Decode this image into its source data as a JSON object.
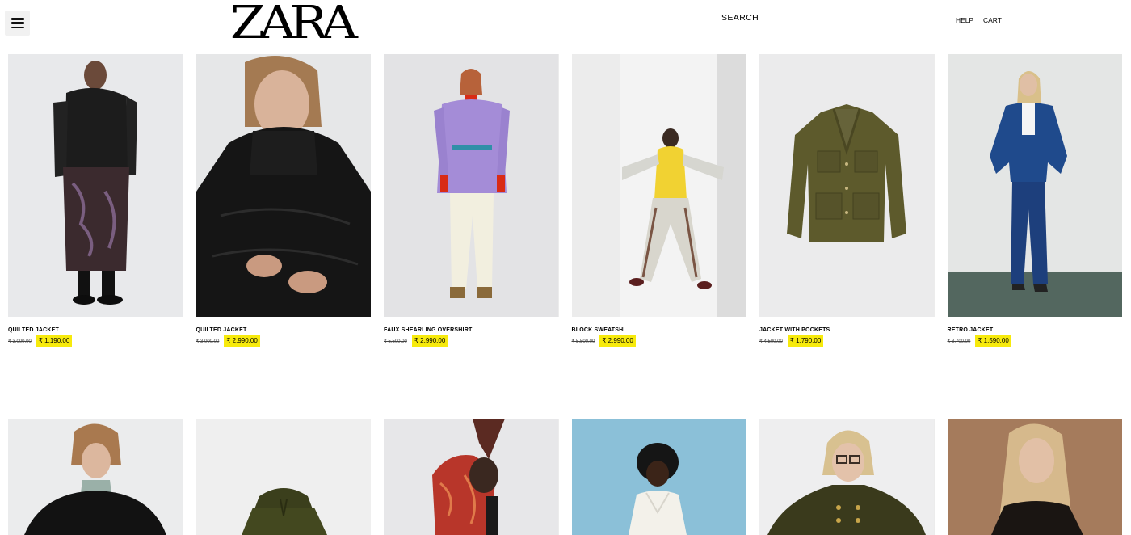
{
  "header": {
    "logo_text": "ZARA",
    "search_label": "SEARCH",
    "help_label": "HELP",
    "cart_label": "CART"
  },
  "products_row1": [
    {
      "name": "QUILTED JACKET",
      "old_price": "₹ 3,000.00",
      "new_price": "₹ 1,190.00",
      "image": "woman-black-puffer-jacket-patterned-skirt"
    },
    {
      "name": "QUILTED JACKET",
      "old_price": "₹ 3,000.00",
      "new_price": "₹ 2,990.00",
      "image": "woman-black-quilted-jacket-closeup"
    },
    {
      "name": "FAUX SHEARLING OVERSHIRT",
      "old_price": "₹ 5,500.00",
      "new_price": "₹ 2,990.00",
      "image": "woman-lilac-shearling-overshirt"
    },
    {
      "name": "BLOCK SWEATSHI",
      "old_price": "₹ 5,500.00",
      "new_price": "₹ 2,990.00",
      "image": "model-yellow-grey-tracksuit"
    },
    {
      "name": "JACKET WITH POCKETS",
      "old_price": "₹ 4,500.00",
      "new_price": "₹ 1,790.00",
      "image": "khaki-jacket-flat-lay"
    },
    {
      "name": "RETRO JACKET",
      "old_price": "₹ 3,700.00",
      "new_price": "₹ 1,590.00",
      "image": "woman-blue-retro-jacket"
    }
  ],
  "products_row2": [
    {
      "image": "woman-black-shirt-scarf"
    },
    {
      "image": "khaki-hooded-jacket"
    },
    {
      "image": "model-red-printed-top"
    },
    {
      "image": "woman-white-blouse-blue-background"
    },
    {
      "image": "woman-green-double-breasted-coat-glasses"
    },
    {
      "image": "woman-black-blazer-brown-background"
    }
  ],
  "colors": {
    "price_highlight": "#f7ea0c",
    "background": "#ffffff"
  }
}
